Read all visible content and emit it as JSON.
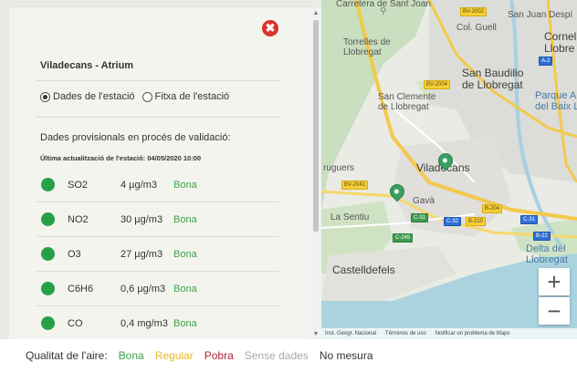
{
  "map": {
    "labels": {
      "top_street": "Carretera de Sant Joan",
      "torrelles": "Torrelles de\nLlobregat",
      "col_guell": "Col. Guell",
      "san_juan": "San Juan Despí",
      "cornella": "Cornell\nLlobre",
      "san_baudilio": "San Baudilio\nde Llobregat",
      "san_clemente": "San Clemente\nde Llobregat",
      "parque": "Parque A\ndel Baix Ll",
      "viladecans": "Viladecans",
      "gava": "Gavà",
      "bruguers": "ruguers",
      "la_sentiu": "La Sentiu",
      "castelldefels": "Castelldefels",
      "delta": "Delta del\nLlobregat"
    },
    "road_badges": [
      "BV-2002",
      "BV-2004",
      "BV-2041",
      "C-32",
      "B-210",
      "C-31",
      "B-204",
      "C-245",
      "A-2",
      "B-22",
      "C-31"
    ],
    "zoom_in": "+",
    "zoom_out": "−",
    "attribution": [
      "Inst. Geogr. Nacional",
      "Términos de uso",
      "Notificar un problema de Maps"
    ]
  },
  "panel": {
    "close_icon": "✖",
    "station_name": "Viladecans - Atrium",
    "radio_station_data": "Dades de l'estació",
    "radio_station_sheet": "Fitxa de l'estació",
    "provisional_note": "Dades provisionals en procés de validació:",
    "last_update": "Última actualització de l'estació: 04/05/2020 10:00",
    "pollutants": [
      {
        "name": "SO2",
        "value": "4 µg/m3",
        "quality": "Bona"
      },
      {
        "name": "NO2",
        "value": "30 µg/m3",
        "quality": "Bona"
      },
      {
        "name": "O3",
        "value": "27 µg/m3",
        "quality": "Bona"
      },
      {
        "name": "C6H6",
        "value": "0,6 µg/m3",
        "quality": "Bona"
      },
      {
        "name": "CO",
        "value": "0,4 mg/m3",
        "quality": "Bona"
      }
    ]
  },
  "legend": {
    "title": "Qualitat de l'aire:",
    "items": [
      {
        "label": "Bona",
        "color": "#3ea34a"
      },
      {
        "label": "Regular",
        "color": "#e8b92b"
      },
      {
        "label": "Pobra",
        "color": "#b0243a"
      },
      {
        "label": "Sense dades",
        "color": "#a8a8a8"
      },
      {
        "label": "No mesura",
        "color": "#333333"
      }
    ]
  }
}
